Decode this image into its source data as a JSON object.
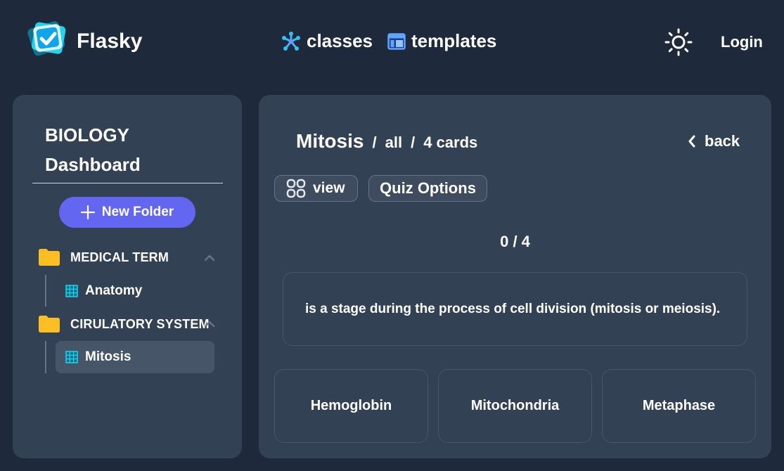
{
  "app": {
    "brand": "Flasky"
  },
  "nav": {
    "classes_label": "classes",
    "templates_label": "templates",
    "login_label": "Login"
  },
  "sidebar": {
    "subject": "BIOLOGY",
    "subtitle": "Dashboard",
    "new_folder_label": "New Folder",
    "folders": [
      {
        "name": "MEDICAL TERM",
        "files": [
          {
            "name": "Anatomy",
            "active": false
          }
        ]
      },
      {
        "name": "CIRULATORY SYSTEM",
        "files": [
          {
            "name": "Mitosis",
            "active": true
          }
        ]
      }
    ]
  },
  "deck": {
    "title": "Mitosis",
    "filter": "all",
    "card_count": "4 cards",
    "back_label": "back",
    "view_label": "view",
    "quiz_options_label": "Quiz Options",
    "progress": "0 / 4",
    "question": "is a stage during the process of cell division (mitosis or meiosis).",
    "answers": [
      "Hemoglobin",
      "Mitochondria",
      "Metaphase"
    ]
  },
  "colors": {
    "background": "#1e293b",
    "panel": "#334155",
    "accent": "#6366f1",
    "folder": "#fbbf24",
    "classes_icon": "#38bdf8",
    "templates_icon": "#60a5fa"
  },
  "icons": [
    "flasky-logo-icon",
    "classes-icon",
    "templates-icon",
    "sun-icon",
    "plus-icon",
    "folder-icon",
    "chevron-up-icon",
    "table-icon",
    "chevron-left-icon",
    "grid-view-icon"
  ]
}
